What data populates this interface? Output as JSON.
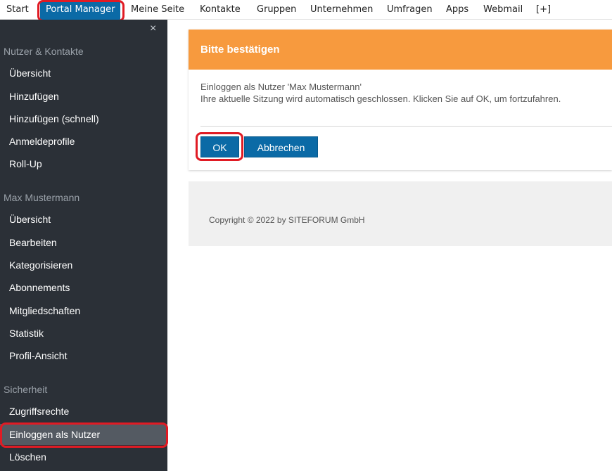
{
  "topnav": {
    "items": [
      "Start",
      "Portal Manager",
      "Meine Seite",
      "Kontakte",
      "Gruppen",
      "Unternehmen",
      "Umfragen",
      "Apps",
      "Webmail",
      "[+]"
    ]
  },
  "sidebar": {
    "close_icon": "×",
    "sections": [
      {
        "title": "Nutzer & Kontakte",
        "items": [
          "Übersicht",
          "Hinzufügen",
          "Hinzufügen (schnell)",
          "Anmeldeprofile",
          "Roll-Up"
        ]
      },
      {
        "title": "Max Mustermann",
        "items": [
          "Übersicht",
          "Bearbeiten",
          "Kategorisieren",
          "Abonnements",
          "Mitgliedschaften",
          "Statistik",
          "Profil-Ansicht"
        ]
      },
      {
        "title": "Sicherheit",
        "items": [
          "Zugriffsrechte",
          "Einloggen als Nutzer",
          "Löschen"
        ]
      }
    ]
  },
  "dialog": {
    "title": "Bitte bestätigen",
    "line1": "Einloggen als Nutzer 'Max Mustermann'",
    "line2": "Ihre aktuelle Sitzung wird automatisch geschlossen. Klicken Sie auf OK, um fortzufahren.",
    "ok_label": "OK",
    "cancel_label": "Abbrechen"
  },
  "footer": {
    "copyright": "Copyright © 2022 by SITEFORUM GmbH"
  },
  "colors": {
    "accent": "#0b6aa6",
    "dialog_header": "#f79a3e",
    "sidebar_bg": "#2b3037",
    "highlight": "#e01b24"
  }
}
